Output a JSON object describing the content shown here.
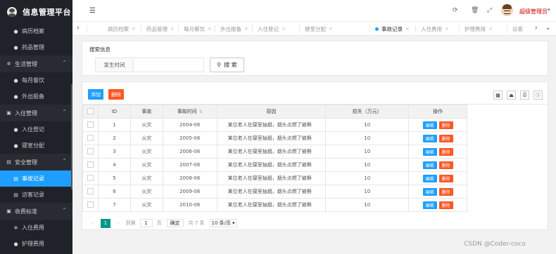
{
  "app": {
    "title": "信息管理平台"
  },
  "sidebar": {
    "items": [
      {
        "label": "病历档案",
        "icon": "user-icon",
        "type": "item"
      },
      {
        "label": "药品管理",
        "icon": "user-icon",
        "type": "item"
      },
      {
        "label": "生活管理",
        "icon": "gear-icon",
        "type": "group"
      },
      {
        "label": "每月餐饮",
        "icon": "user-icon",
        "type": "item"
      },
      {
        "label": "外出报备",
        "icon": "user-icon",
        "type": "item"
      },
      {
        "label": "入住管理",
        "icon": "doc-icon",
        "type": "group"
      },
      {
        "label": "入住登记",
        "icon": "user-icon",
        "type": "item"
      },
      {
        "label": "寝室分配",
        "icon": "user-icon",
        "type": "item"
      },
      {
        "label": "安全管理",
        "icon": "calendar-icon",
        "type": "group"
      },
      {
        "label": "事故记录",
        "icon": "list-icon",
        "type": "item",
        "active": true
      },
      {
        "label": "访客记录",
        "icon": "list-icon",
        "type": "item"
      },
      {
        "label": "收费标准",
        "icon": "doc-icon",
        "type": "group"
      },
      {
        "label": "入住费用",
        "icon": "gear-icon",
        "type": "item"
      },
      {
        "label": "护理费用",
        "icon": "user-icon",
        "type": "item"
      }
    ]
  },
  "header": {
    "user_name": "超级管理员"
  },
  "tabs": [
    {
      "label": "病历档案"
    },
    {
      "label": "药品管理"
    },
    {
      "label": "每月餐饮"
    },
    {
      "label": "外出报备"
    },
    {
      "label": "入住登记"
    },
    {
      "label": "寝室分配"
    },
    {
      "label": "事故记录",
      "active": true
    },
    {
      "label": "入住费用"
    },
    {
      "label": "护理费用"
    },
    {
      "label": "访客"
    }
  ],
  "search": {
    "legend": "搜索信息",
    "field_label": "发生时间",
    "field_value": "",
    "button_label": "搜 索"
  },
  "toolbar": {
    "add_label": "添加",
    "delete_label": "删除"
  },
  "table": {
    "headers": [
      "ID",
      "事故",
      "事故时间",
      "原因",
      "损失（万元）",
      "操作"
    ],
    "edit_label": "编辑",
    "delete_label": "删除",
    "rows": [
      {
        "id": "1",
        "accident": "火灾",
        "time": "2004-06",
        "reason": "某位老人在寝室抽烟，烟头点燃了被褥",
        "loss": "10"
      },
      {
        "id": "2",
        "accident": "火灾",
        "time": "2005-06",
        "reason": "某位老人在寝室抽烟，烟头点燃了被褥",
        "loss": "10"
      },
      {
        "id": "3",
        "accident": "火灾",
        "time": "2006-06",
        "reason": "某位老人在寝室抽烟，烟头点燃了被褥",
        "loss": "10"
      },
      {
        "id": "4",
        "accident": "火灾",
        "time": "2007-06",
        "reason": "某位老人在寝室抽烟，烟头点燃了被褥",
        "loss": "10"
      },
      {
        "id": "5",
        "accident": "火灾",
        "time": "2008-06",
        "reason": "某位老人在寝室抽烟，烟头点燃了被褥",
        "loss": "10"
      },
      {
        "id": "6",
        "accident": "火灾",
        "time": "2009-06",
        "reason": "某位老人在寝室抽烟，烟头点燃了被褥",
        "loss": "10"
      },
      {
        "id": "7",
        "accident": "火灾",
        "time": "2010-06",
        "reason": "某位老人在寝室抽烟，烟头点燃了被褥",
        "loss": "10"
      }
    ]
  },
  "pager": {
    "current": "1",
    "goto_label": "到第",
    "page_value": "1",
    "page_unit": "页",
    "confirm_label": "确定",
    "total_label": "共 7 条",
    "page_size": "10 条/页"
  },
  "watermark": "CSDN @Coder-coco"
}
